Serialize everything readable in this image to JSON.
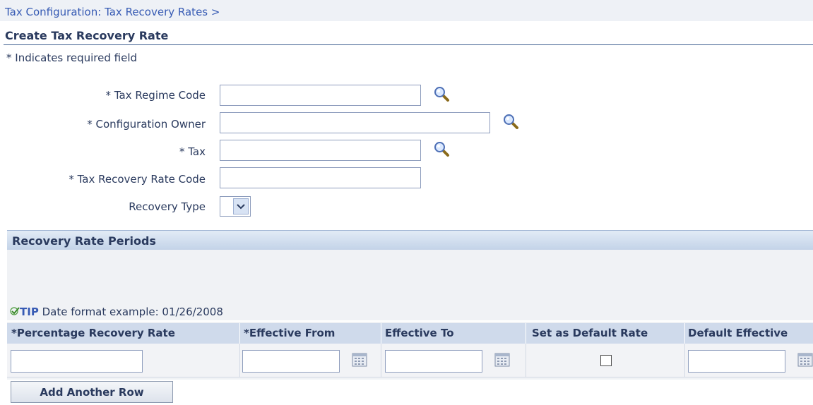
{
  "breadcrumb": "Tax Configuration: Tax Recovery Rates >",
  "page_title": "Create Tax Recovery Rate",
  "required_note": "* Indicates required field",
  "form": {
    "tax_regime_code": {
      "label": "* Tax Regime Code",
      "value": ""
    },
    "configuration_owner": {
      "label": "* Configuration Owner",
      "value": ""
    },
    "tax": {
      "label": "* Tax",
      "value": ""
    },
    "tax_recovery_rate_code": {
      "label": "* Tax Recovery Rate Code",
      "value": ""
    },
    "recovery_type": {
      "label": "Recovery Type",
      "value": ""
    }
  },
  "periods": {
    "title": "Recovery Rate Periods",
    "tip_label": "TIP",
    "tip_text": "Date format example: 01/26/2008",
    "columns": [
      "*Percentage Recovery Rate",
      "*Effective From",
      "Effective To",
      "Set as Default Rate",
      "Default Effective"
    ],
    "rows": [
      {
        "percentage_recovery_rate": "",
        "effective_from": "",
        "effective_to": "",
        "set_as_default_rate": false,
        "default_effective": ""
      }
    ],
    "add_row_label": "Add Another Row"
  },
  "icons": {
    "search": "magnifier-icon",
    "calendar": "calendar-icon",
    "dropdown": "chevron-down-icon",
    "tip": "checkmark-icon"
  },
  "colors": {
    "link": "#375bb4",
    "text": "#2a3a5e",
    "header_bg": "#cfdaeb",
    "section_bg": "#f0f2f5"
  }
}
